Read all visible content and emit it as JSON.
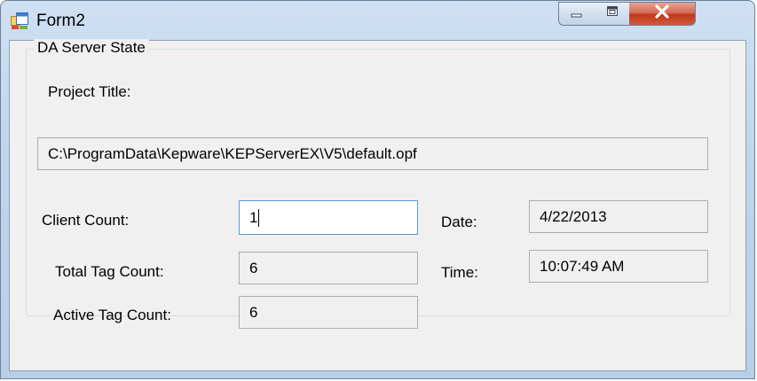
{
  "window": {
    "title": "Form2",
    "icon": "winforms-app-icon",
    "controls": {
      "minimize": "minimize-icon",
      "maximize": "maximize-icon",
      "close": "close-icon"
    }
  },
  "group": {
    "title": "DA Server State",
    "project_title_label": "Project Title:",
    "project_title_value": "C:\\ProgramData\\Kepware\\KEPServerEX\\V5\\default.opf",
    "client_count_label": "Client Count:",
    "client_count_value": "1",
    "total_tag_count_label": "Total Tag Count:",
    "total_tag_count_value": "6",
    "active_tag_count_label": "Active Tag Count:",
    "active_tag_count_value": "6",
    "date_label": "Date:",
    "date_value": "4/22/2013",
    "time_label": "Time:",
    "time_value": "10:07:49 AM"
  },
  "colors": {
    "titlebar": "#c0d5ec",
    "close_button": "#c1381c",
    "client_bg": "#f0f0f0",
    "focus_border": "#5b9bd5"
  }
}
